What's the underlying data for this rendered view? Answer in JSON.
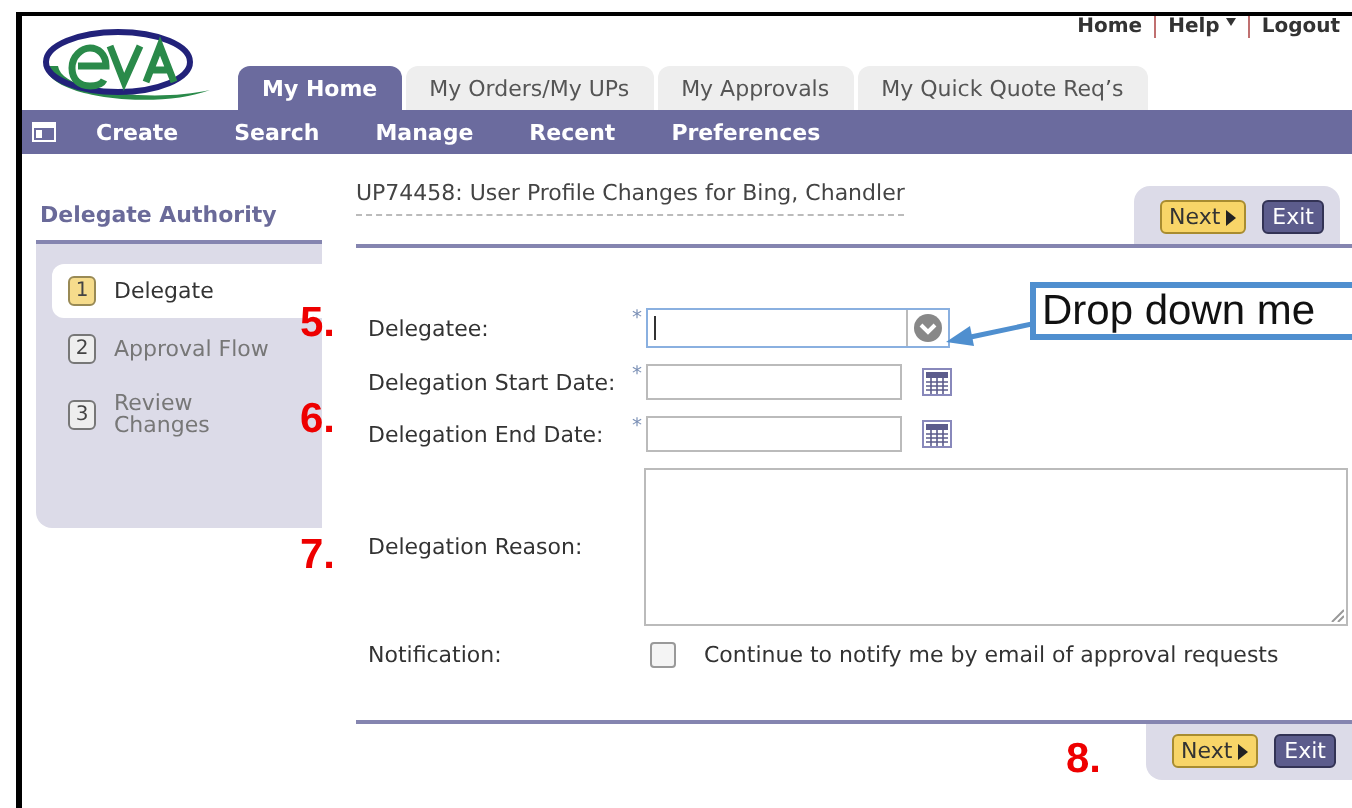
{
  "top_links": [
    {
      "label": "Home",
      "dropdown": false
    },
    {
      "label": "Help",
      "dropdown": true
    },
    {
      "label": "Logout",
      "dropdown": false
    }
  ],
  "tabs": [
    {
      "label": "My Home",
      "selected": true
    },
    {
      "label": "My Orders/My UPs",
      "selected": false
    },
    {
      "label": "My Approvals",
      "selected": false
    },
    {
      "label": "My Quick Quote Req’s",
      "selected": false
    }
  ],
  "menu": [
    "Create",
    "Search",
    "Manage",
    "Recent",
    "Preferences"
  ],
  "sidebar": {
    "title": "Delegate Authority",
    "steps": [
      {
        "number": "1",
        "label": "Delegate",
        "selected": true
      },
      {
        "number": "2",
        "label": "Approval Flow",
        "selected": false
      },
      {
        "number": "3",
        "label": "Review Changes",
        "selected": false
      }
    ]
  },
  "page_title": "UP74458: User Profile Changes for Bing, Chandler",
  "top_buttons": [
    {
      "kind": "next",
      "label": "Next"
    },
    {
      "kind": "exit",
      "label": "Exit"
    }
  ],
  "fields": [
    {
      "kind": "combo",
      "label": "Delegatee:",
      "required_mark": "*",
      "focused": true
    },
    {
      "kind": "date",
      "label": "Delegation Start Date:",
      "required_mark": "*",
      "focused": false
    },
    {
      "kind": "date",
      "label": "Delegation End Date:",
      "required_mark": "*",
      "focused": false
    },
    {
      "kind": "textarea",
      "label": "Delegation Reason:"
    },
    {
      "kind": "checkbox",
      "label": "Notification:",
      "text": "Continue to notify me by email of approval requests",
      "checked": false
    }
  ],
  "bottom_buttons": [
    {
      "kind": "next",
      "label": "Next"
    },
    {
      "kind": "exit",
      "label": "Exit"
    }
  ],
  "annotations": [
    "5.",
    "6.",
    "7.",
    "8."
  ],
  "callout": {
    "text": "Drop down me"
  }
}
